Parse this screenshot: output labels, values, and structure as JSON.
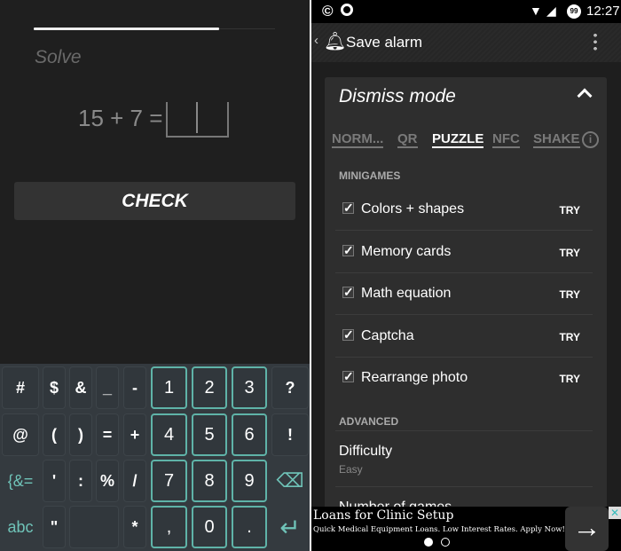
{
  "puzzle": {
    "progress": 0.77,
    "prompt": "Solve",
    "equation": "15 + 7 =",
    "answer": "",
    "check_label": "CHECK"
  },
  "keyboard": {
    "rows": [
      [
        "#",
        "$",
        "&",
        "_",
        "-",
        "1",
        "2",
        "3",
        "?"
      ],
      [
        "@",
        "(",
        ")",
        "=",
        "+",
        "4",
        "5",
        "6",
        "!"
      ],
      [
        "{&=",
        "'",
        ":",
        "%",
        "/",
        "7",
        "8",
        "9",
        "⌫"
      ],
      [
        "abc",
        "\"",
        "",
        "*",
        ",",
        "0",
        ".",
        "↵"
      ]
    ],
    "accent": "#6fc3b8"
  },
  "status": {
    "time": "12:27",
    "battery": "99"
  },
  "toolbar": {
    "title": "Save alarm"
  },
  "dismiss": {
    "title": "Dismiss mode",
    "tabs": [
      {
        "label": "NORM..."
      },
      {
        "label": "QR"
      },
      {
        "label": "PUZZLE",
        "selected": true
      },
      {
        "label": "NFC"
      },
      {
        "label": "SHAKE"
      }
    ],
    "minigames_header": "MINIGAMES",
    "minigames": [
      {
        "label": "Colors + shapes",
        "checked": true,
        "action": "TRY"
      },
      {
        "label": "Memory cards",
        "checked": true,
        "action": "TRY"
      },
      {
        "label": "Math equation",
        "checked": true,
        "action": "TRY"
      },
      {
        "label": "Captcha",
        "checked": true,
        "action": "TRY"
      },
      {
        "label": "Rearrange photo",
        "checked": true,
        "action": "TRY"
      }
    ],
    "advanced_header": "ADVANCED",
    "difficulty_label": "Difficulty",
    "difficulty_value": "Easy",
    "number_of_games_label": "Number of games"
  },
  "ad": {
    "title": "Loans for Clinic Setup",
    "text": "Quick Medical Equipment Loans. Low Interest Rates. Apply Now!"
  }
}
